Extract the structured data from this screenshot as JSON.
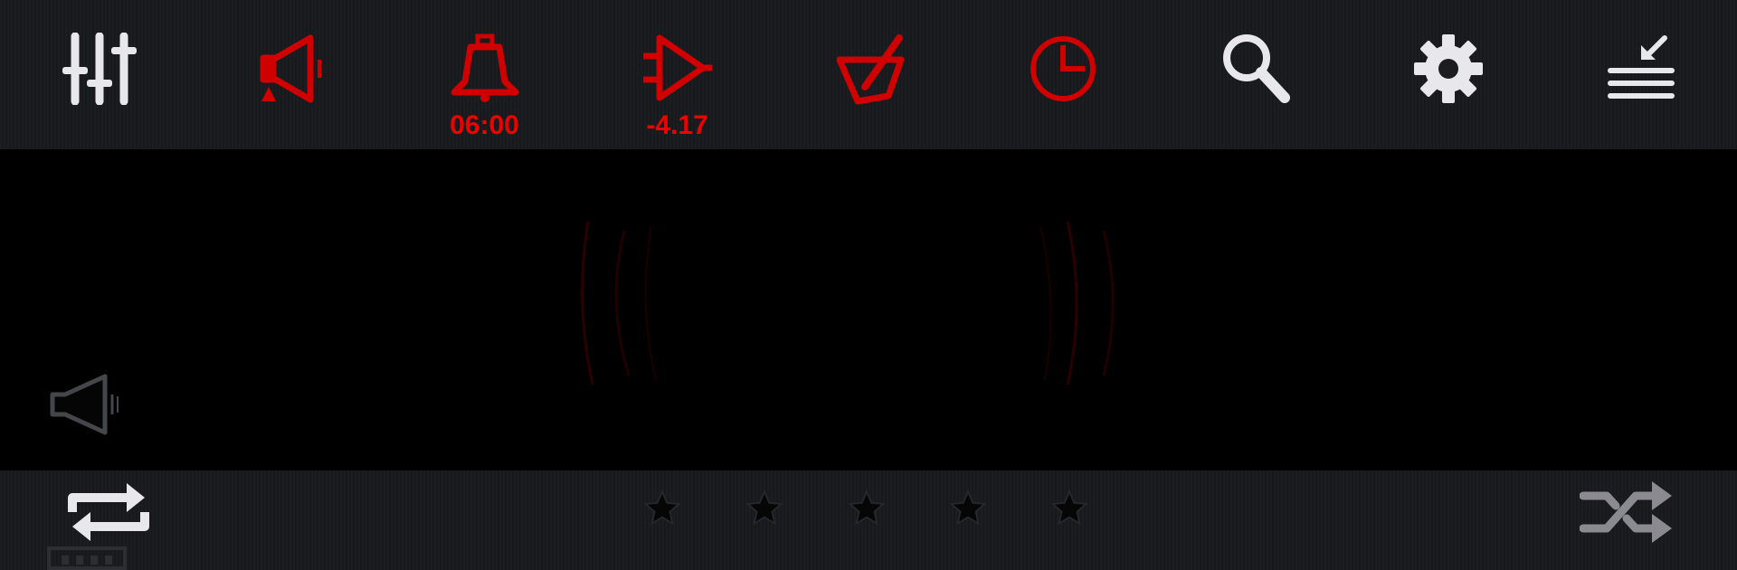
{
  "toolbar": {
    "equalizer": {
      "icon": "equalizer-icon"
    },
    "volume": {
      "icon": "speaker-red-icon"
    },
    "alarm": {
      "icon": "bell-icon",
      "label": "06:00"
    },
    "gain": {
      "icon": "amplifier-icon",
      "label": "-4.17"
    },
    "theme": {
      "icon": "mortar-pestle-icon"
    },
    "sleep_timer": {
      "icon": "clock-icon"
    },
    "search": {
      "icon": "search-icon"
    },
    "settings": {
      "icon": "gear-icon"
    },
    "queue": {
      "icon": "queue-list-icon"
    }
  },
  "player": {
    "mute": {
      "icon": "speaker-outline-icon"
    },
    "repeat": {
      "icon": "repeat-icon"
    },
    "shuffle": {
      "icon": "shuffle-icon"
    },
    "rating": {
      "max": 5,
      "value": 0,
      "icon": "star-icon"
    }
  },
  "colors": {
    "accent": "#e00000",
    "icon_light": "#e8e8ec",
    "icon_dim": "#8a8a90",
    "bar_bg": "#1b1d21",
    "background": "#000000"
  }
}
